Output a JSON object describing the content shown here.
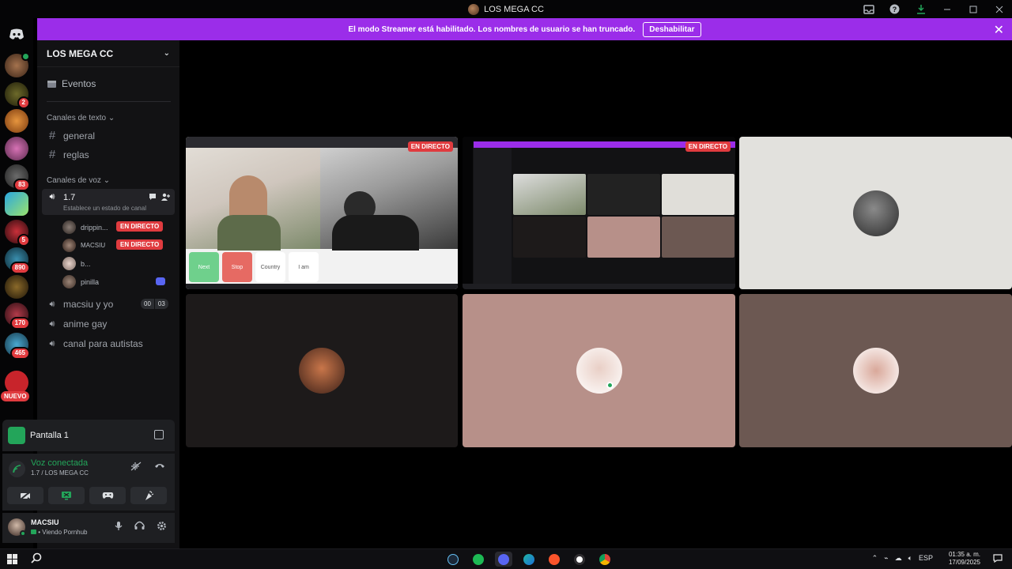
{
  "window": {
    "title": "LOS MEGA CC",
    "controls": [
      "inbox-icon",
      "help-icon",
      "download-icon",
      "minimize-icon",
      "maximize-icon",
      "close-icon"
    ]
  },
  "banner": {
    "text": "El modo Streamer está habilitado. Los nombres de usuario se han truncado.",
    "button": "Deshabilitar",
    "color": "#9b2de9"
  },
  "rail": {
    "badges": [
      "2",
      "83",
      "5",
      "890",
      "170",
      "465"
    ],
    "new_label": "NUEVO"
  },
  "server": {
    "name": "LOS MEGA CC",
    "events_label": "Eventos",
    "text_category": "Canales de texto",
    "text_channels": [
      "general",
      "reglas"
    ],
    "voice_category": "Canales de voz",
    "active_voice": {
      "name": "1.7",
      "status": "Establece un estado de canal"
    },
    "members": [
      {
        "name": "drippin...",
        "badge": "EN DIRECTO"
      },
      {
        "name": "MACSIU",
        "badge": "EN DIRECTO"
      },
      {
        "name": "b...",
        "badge": ""
      },
      {
        "name": "pinilla",
        "badge": ""
      }
    ],
    "voice_channels": [
      {
        "name": "macsiu y yo",
        "count_left": "00",
        "count_right": "03"
      },
      {
        "name": "anime gay"
      },
      {
        "name": "canal para autistas"
      }
    ]
  },
  "screen_share": {
    "label": "Pantalla 1"
  },
  "voice": {
    "title": "Voz conectada",
    "subtitle": "1.7 / LOS MEGA CC"
  },
  "user": {
    "name": "MACSIU",
    "status": "Viendo Pornhub"
  },
  "grid": {
    "live_label": "EN DIRECTO",
    "stream_buttons": [
      "Next",
      "Stop",
      "Country",
      "I am"
    ]
  },
  "taskbar": {
    "lang": "ESP",
    "time": "01:35 a. m.",
    "date": "17/09/2025",
    "colors": {
      "accent_green": "#23a55a",
      "live_red": "#e03b3f",
      "blurple": "#5865f2"
    }
  }
}
